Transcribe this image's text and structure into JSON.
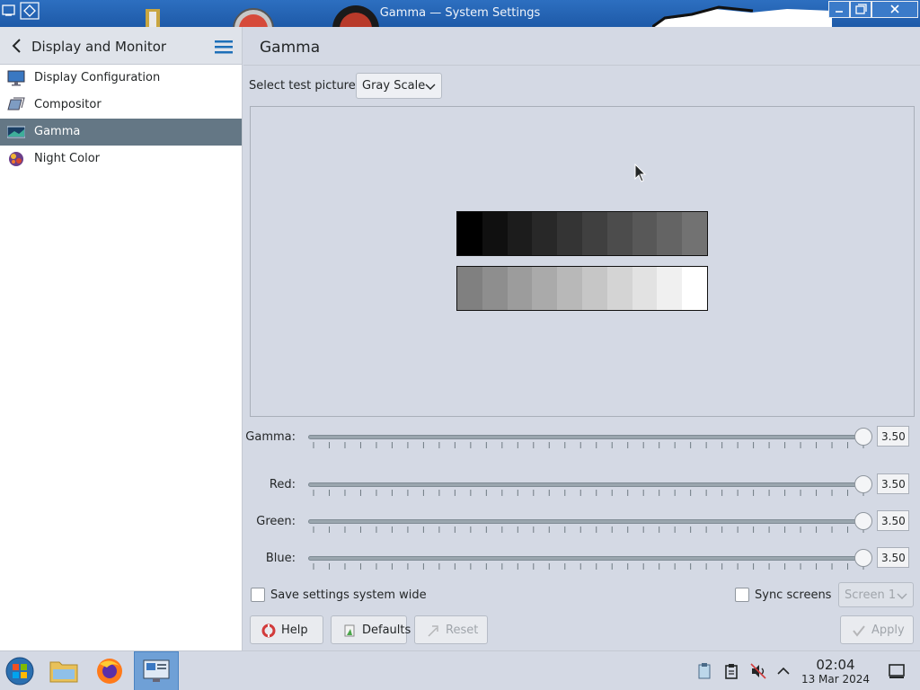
{
  "window": {
    "title": "Gamma — System Settings"
  },
  "sidebar": {
    "header_title": "Display and Monitor",
    "items": [
      {
        "label": "Display Configuration",
        "icon": "display-config-icon",
        "active": false
      },
      {
        "label": "Compositor",
        "icon": "compositor-icon",
        "active": false
      },
      {
        "label": "Gamma",
        "icon": "gamma-icon",
        "active": true
      },
      {
        "label": "Night Color",
        "icon": "night-color-icon",
        "active": false
      }
    ]
  },
  "main": {
    "title": "Gamma",
    "test_picture_label": "Select test picture:",
    "test_picture_value": "Gray Scale",
    "sliders": [
      {
        "label": "Gamma:",
        "value": "3.50",
        "fraction": 1.0
      },
      {
        "label": "Red:",
        "value": "3.50",
        "fraction": 1.0
      },
      {
        "label": "Green:",
        "value": "3.50",
        "fraction": 1.0
      },
      {
        "label": "Blue:",
        "value": "3.50",
        "fraction": 1.0
      }
    ],
    "save_system_wide_label": "Save settings system wide",
    "sync_screens_label": "Sync screens",
    "screen_select_value": "Screen 1",
    "buttons": {
      "help": "Help",
      "defaults": "Defaults",
      "reset": "Reset",
      "apply": "Apply"
    }
  },
  "gray_strips": {
    "dark": [
      "#000000",
      "#101010",
      "#1c1c1c",
      "#282828",
      "#343434",
      "#404040",
      "#4c4c4c",
      "#585858",
      "#646464",
      "#727272"
    ],
    "light": [
      "#808080",
      "#8e8e8e",
      "#9c9c9c",
      "#aaaaaa",
      "#b8b8b8",
      "#c6c6c6",
      "#d4d4d4",
      "#e2e2e2",
      "#f0f0f0",
      "#ffffff"
    ]
  },
  "taskbar": {
    "time": "02:04",
    "date": "13 Mar 2024"
  },
  "colors": {
    "accent": "#647785",
    "titlebar": "#1e5aa8"
  }
}
